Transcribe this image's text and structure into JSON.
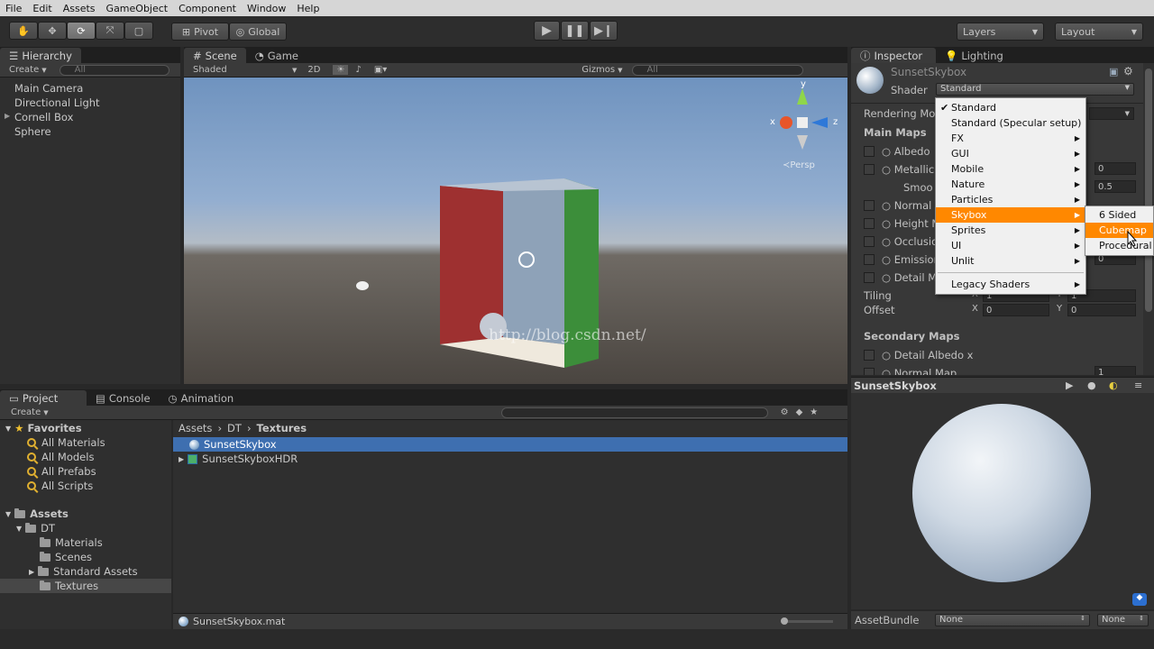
{
  "menubar": [
    "File",
    "Edit",
    "Assets",
    "GameObject",
    "Component",
    "Window",
    "Help"
  ],
  "toolbar": {
    "pivot": "Pivot",
    "global": "Global",
    "layers": "Layers",
    "layout": "Layout"
  },
  "hierarchy": {
    "tab": "Hierarchy",
    "create": "Create",
    "search": "All",
    "items": [
      "Main Camera",
      "Directional Light",
      "Cornell Box",
      "Sphere"
    ]
  },
  "scene": {
    "tabs": [
      "Scene",
      "Game"
    ],
    "shading": "Shaded",
    "mode2d": "2D",
    "gizmos": "Gizmos",
    "search": "All",
    "persp": "Persp",
    "axis_y": "y",
    "axis_x": "x",
    "axis_z": "z",
    "watermark": "http://blog.csdn.net/"
  },
  "project": {
    "tabs": [
      "Project",
      "Console",
      "Animation"
    ],
    "create": "Create",
    "favorites_label": "Favorites",
    "favorites": [
      "All Materials",
      "All Models",
      "All Prefabs",
      "All Scripts"
    ],
    "assets_label": "Assets",
    "tree": [
      "DT",
      "Materials",
      "Scenes",
      "Standard Assets",
      "Textures"
    ],
    "breadcrumb": [
      "Assets",
      "DT",
      "Textures"
    ],
    "files": [
      "SunsetSkybox",
      "SunsetSkyboxHDR"
    ],
    "status": "SunsetSkybox.mat"
  },
  "inspector": {
    "tabs": [
      "Inspector",
      "Lighting"
    ],
    "name": "SunsetSkybox",
    "shader_label": "Shader",
    "shader_value": "Standard",
    "rendering_mode": "Rendering Mo",
    "main_maps": "Main Maps",
    "props": [
      "Albedo",
      "Metallic",
      "Smoo",
      "Normal M",
      "Height M",
      "Occlusio",
      "Emission",
      "Detail M"
    ],
    "metallic_value": "0",
    "smooth_value": "0.5",
    "emission_value": "0",
    "tiling": "Tiling",
    "offset": "Offset",
    "tiling_x": "1",
    "tiling_y": "1",
    "offset_x": "0",
    "offset_y": "0",
    "x": "X",
    "y": "Y",
    "secondary_maps": "Secondary Maps",
    "detail_albedo": "Detail Albedo x",
    "normal_map": "Normal Map",
    "normal_value": "1"
  },
  "preview": {
    "title": "SunsetSkybox",
    "assetbundle_label": "AssetBundle",
    "bundle": "None",
    "variant": "None"
  },
  "shader_menu": {
    "items": [
      "Standard",
      "Standard (Specular setup)",
      "FX",
      "GUI",
      "Mobile",
      "Nature",
      "Particles",
      "Skybox",
      "Sprites",
      "UI",
      "Unlit",
      "Legacy Shaders"
    ],
    "checked": "Standard",
    "highlighted": "Skybox"
  },
  "skybox_menu": {
    "items": [
      "6 Sided",
      "Cubemap",
      "Procedural"
    ],
    "highlighted": "Cubemap"
  },
  "colors": {
    "accent": "#ff8800",
    "selection": "#3e6fb0"
  }
}
